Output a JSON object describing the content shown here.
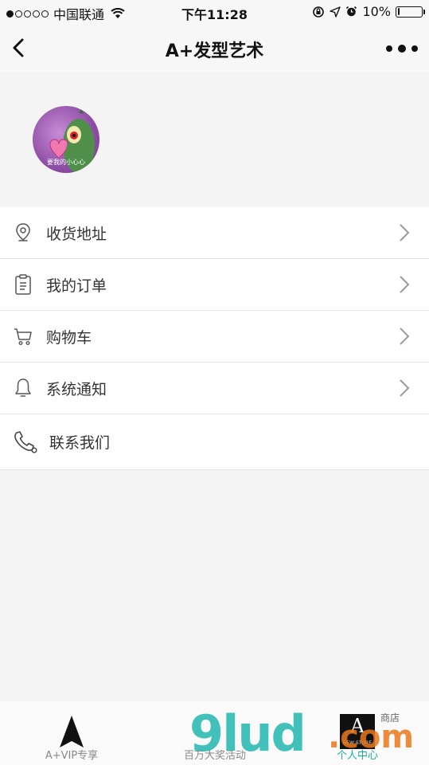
{
  "status_bar": {
    "carrier": "中国联通",
    "time": "下午11:28",
    "battery_percent": "10%",
    "battery_level": 0.1,
    "signal_bars_filled": 1,
    "signal_bars_total": 5
  },
  "nav": {
    "title": "A+发型艺术",
    "back_icon": "chevron-left-icon",
    "more_icon": "more-dots-icon"
  },
  "profile": {
    "avatar_caption": "要我的小心心"
  },
  "menu": {
    "items": [
      {
        "label": "收货地址",
        "icon": "location-pin-icon",
        "chevron": true
      },
      {
        "label": "我的订单",
        "icon": "clipboard-icon",
        "chevron": true
      },
      {
        "label": "购物车",
        "icon": "cart-icon",
        "chevron": true
      },
      {
        "label": "系统通知",
        "icon": "bell-icon",
        "chevron": true
      },
      {
        "label": "联系我们",
        "icon": "phone-icon",
        "chevron": false
      }
    ]
  },
  "tabs": [
    {
      "label": "A+VIP专享",
      "icon": "arrow-icon",
      "active": false
    },
    {
      "label": "百万大奖活动",
      "icon": "",
      "active": false
    },
    {
      "label": "个人中心",
      "icon": "store-logo-icon",
      "active": true
    }
  ],
  "store_logo": {
    "letter": "A",
    "subtext": "NEW STORE"
  },
  "watermark": {
    "main": "9lud",
    "domain": ".com",
    "tag": "商店"
  },
  "colors": {
    "accent_active": "#1aad9e",
    "text_primary": "#333333",
    "divider": "#e3e3e3"
  }
}
